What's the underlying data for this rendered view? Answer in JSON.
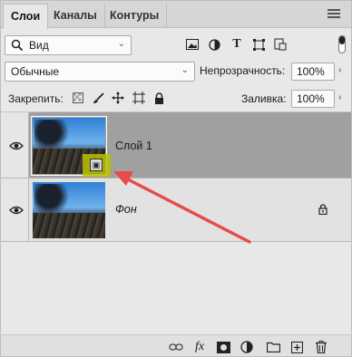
{
  "tabs": [
    {
      "label": "Слои",
      "active": true
    },
    {
      "label": "Каналы",
      "active": false
    },
    {
      "label": "Контуры",
      "active": false
    }
  ],
  "filter": {
    "kind_label": "Вид"
  },
  "blend": {
    "mode_label": "Обычные",
    "opacity_label": "Непрозрачность:",
    "opacity_value": "100%"
  },
  "lock": {
    "label": "Закрепить:",
    "fill_label": "Заливка:",
    "fill_value": "100%"
  },
  "layers": [
    {
      "name": "Слой 1",
      "selected": true,
      "smart_object": true,
      "locked": false
    },
    {
      "name": "Фон",
      "selected": false,
      "smart_object": false,
      "locked": true,
      "italic": true
    }
  ],
  "colors": {
    "selected_row": "#a0a0a0",
    "annotation_arrow": "#e84b4b",
    "smart_highlight": "#b8c400"
  },
  "icons": [
    "search-icon",
    "image-filter-icon",
    "adjustment-filter-icon",
    "type-filter-icon",
    "shape-filter-icon",
    "smartobject-filter-icon",
    "lock-pixels-icon",
    "lock-brush-icon",
    "lock-position-icon",
    "lock-artboard-icon",
    "lock-all-icon",
    "eye-icon",
    "link-icon",
    "fx-icon",
    "mask-icon",
    "adjustment-icon",
    "folder-icon",
    "new-layer-icon",
    "trash-icon"
  ]
}
